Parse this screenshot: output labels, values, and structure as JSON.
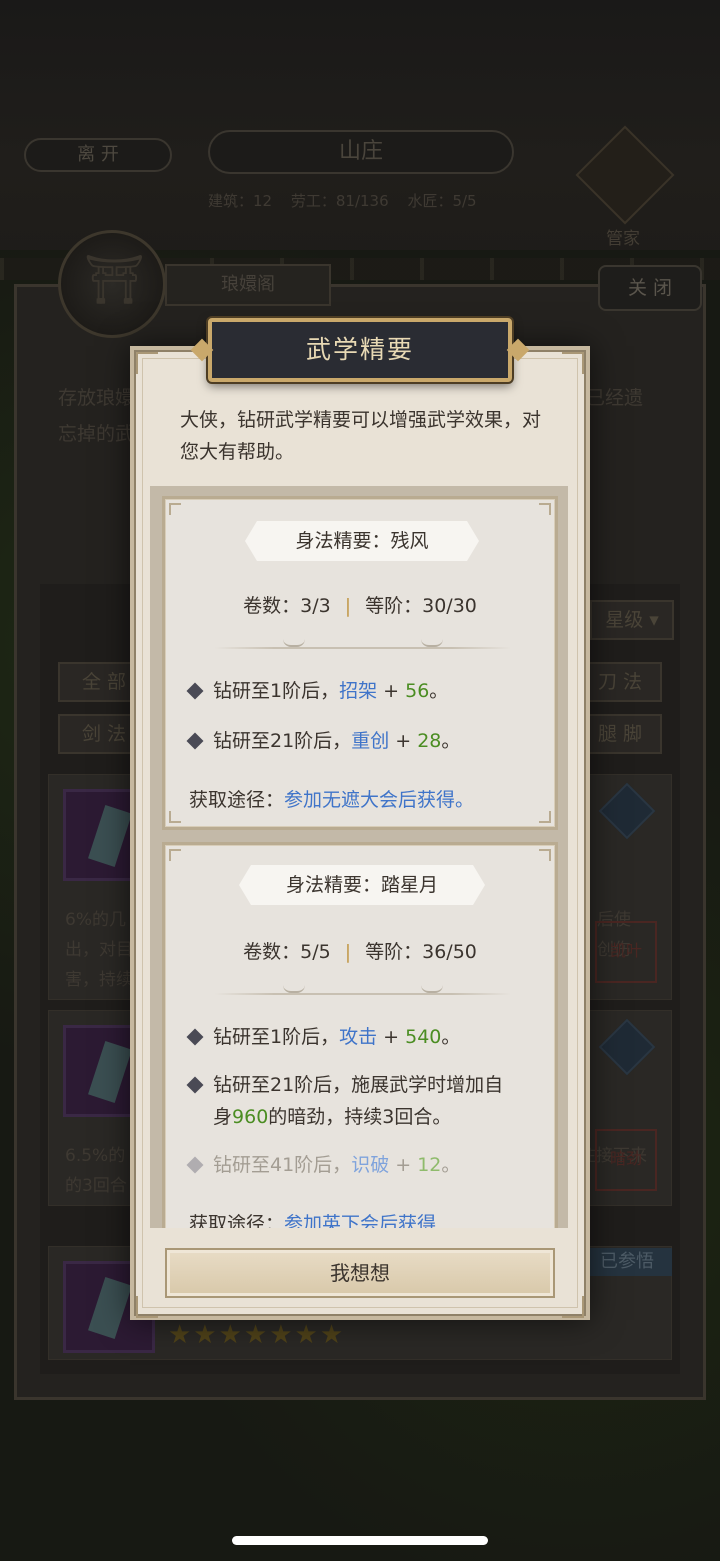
{
  "background": {
    "leave_button": "离 开",
    "location_title": "山庄",
    "stats": [
      "建筑：12",
      "劳工：81/136",
      "水匠：5/5"
    ],
    "manager_label": "管家",
    "building_tab": "琅嬛阁",
    "close_button": "关 闭",
    "description_left": [
      "存放琅嬛",
      "忘掉的武"
    ],
    "description_right": "已经遗",
    "sort_label": "星级",
    "filters": [
      "全 部",
      "刀 法",
      "剑 法",
      "腿 脚"
    ],
    "cards": [
      {
        "text_lines": [
          "6%的几",
          "出，对目",
          "害，持续"
        ],
        "right_lines": [
          "后使",
          "创伤"
        ],
        "seal": "凯叶"
      },
      {
        "text_lines": [
          "6.5%的",
          "的3回合"
        ],
        "right_lines": [
          "注接下来"
        ],
        "seal": "暗劲"
      },
      {
        "status": "已参悟",
        "stars": "★★★★★★★"
      }
    ]
  },
  "dialog": {
    "title": "武学精要",
    "intro": "大侠，钻研武学精要可以增强武学效果，对您大有帮助。",
    "sections": [
      {
        "title": "身法精要：残风",
        "volumes": "卷数：3/3",
        "rank": "等阶：30/30",
        "bullets": [
          {
            "prefix": "钻研至1阶后，",
            "stat": "招架",
            "plus": " + ",
            "value": "56",
            "suffix": "。"
          },
          {
            "prefix": "钻研至21阶后，",
            "stat": "重创",
            "plus": " + ",
            "value": "28",
            "suffix": "。"
          }
        ],
        "acquire_label": "获取途径：",
        "acquire_value": "参加无遮大会后获得。"
      },
      {
        "title": "身法精要：踏星月",
        "volumes": "卷数：5/5",
        "rank": "等阶：36/50",
        "bullets": [
          {
            "prefix": "钻研至1阶后，",
            "stat": "攻击",
            "plus": " + ",
            "value": "540",
            "suffix": "。"
          },
          {
            "line1": "钻研至21阶后，施展武学时增加自",
            "line2_a": "身",
            "line2_value": "960",
            "line2_b": "的暗劲，持续3回合。"
          },
          {
            "prefix": "钻研至41阶后，",
            "stat": "识破",
            "plus": " + ",
            "value": "12",
            "suffix": "。"
          }
        ],
        "acquire_label": "获取途径：",
        "acquire_value": "参加英下会后获得"
      }
    ],
    "confirm_button": "我想想"
  },
  "colors": {
    "accent_gold": "#c9a86b",
    "link_blue": "#3f74c9",
    "value_green": "#4b8d22",
    "dialog_bg": "#e9e2d6"
  }
}
